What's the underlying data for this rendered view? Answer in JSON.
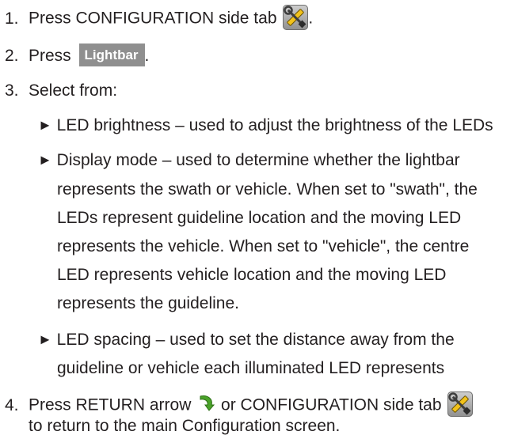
{
  "steps": [
    {
      "number": "1.",
      "text_before": "Press CONFIGURATION side tab",
      "icon": "configuration-tools-icon",
      "text_after": "."
    },
    {
      "number": "2.",
      "text_before": "Press",
      "button_label": "Lightbar",
      "text_after": "."
    },
    {
      "number": "3.",
      "text": "Select from:",
      "options": [
        {
          "marker": "►",
          "lines": [
            "LED brightness – used to adjust the brightness of the LEDs"
          ]
        },
        {
          "marker": "►",
          "lines": [
            "Display mode – used to determine whether the lightbar",
            "represents the swath or vehicle. When set to \"swath\", the",
            "LEDs represent guideline location and the moving LED",
            "represents the vehicle. When set to \"vehicle\", the centre",
            "LED represents vehicle location and the moving LED",
            "represents the guideline."
          ]
        },
        {
          "marker": "►",
          "lines": [
            "LED spacing – used to set the distance away from the",
            "guideline or vehicle each illuminated LED represents"
          ]
        }
      ]
    },
    {
      "number": "4.",
      "text_before": "Press RETURN arrow",
      "return_icon": "return-arrow-icon",
      "text_middle": "or CONFIGURATION side tab",
      "icon": "configuration-tools-icon",
      "line2": "to return to the main Configuration screen."
    }
  ],
  "colors": {
    "text": "#231f20",
    "button_bg": "#8f8f8f",
    "button_text": "#ffffff",
    "return_arrow": "#4aa329"
  }
}
